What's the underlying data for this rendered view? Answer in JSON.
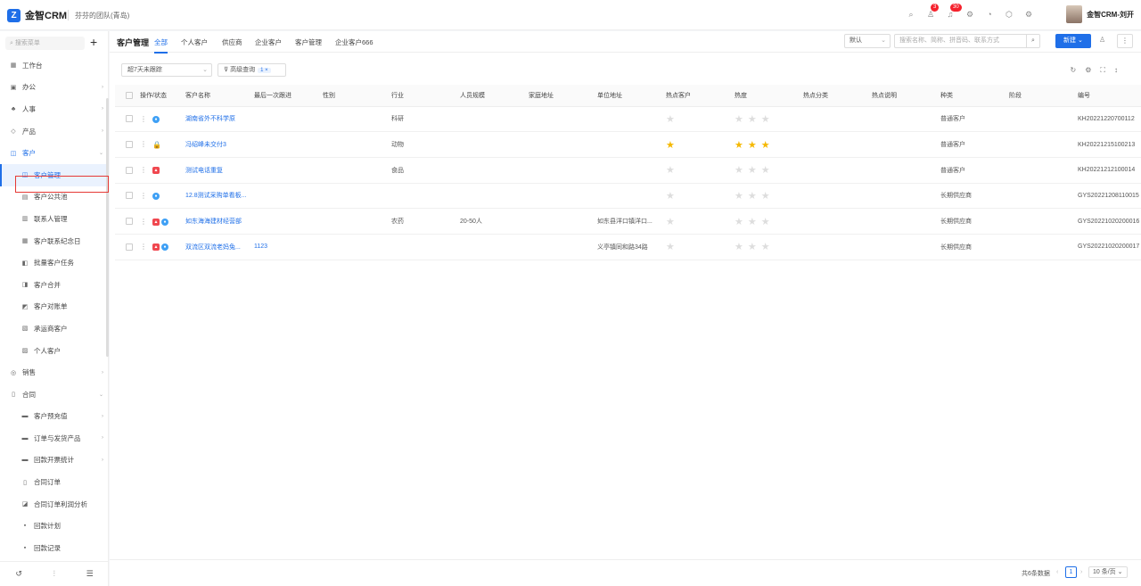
{
  "topbar": {
    "logo_glyph": "Z",
    "app_name": "金智CRM",
    "team": "芬芬的团队(青岛)",
    "icons": [
      "search-icon",
      "contacts-icon",
      "bell-icon",
      "settings-icon",
      "chart-icon",
      "shield-icon",
      "gear-icon"
    ],
    "badges": {
      "contacts": "3",
      "bell": "30"
    },
    "user_name": "金智CRM-刘开"
  },
  "sidebar": {
    "search_placeholder": "搜索菜单",
    "items": [
      {
        "label": "工作台",
        "icon": "▦",
        "level": 0
      },
      {
        "label": "办公",
        "icon": "▣",
        "level": 0,
        "arrow": "›"
      },
      {
        "label": "人事",
        "icon": "♣",
        "level": 0,
        "arrow": "›"
      },
      {
        "label": "产品",
        "icon": "◇",
        "level": 0,
        "arrow": "›"
      },
      {
        "label": "客户",
        "icon": "◫",
        "level": 0,
        "arrow": "⌄",
        "state": "expanded"
      },
      {
        "label": "客户管理",
        "icon": "◫",
        "level": 1,
        "state": "active"
      },
      {
        "label": "客户公共池",
        "icon": "▤",
        "level": 1
      },
      {
        "label": "联系人管理",
        "icon": "▥",
        "level": 1
      },
      {
        "label": "客户联系纪念日",
        "icon": "▦",
        "level": 1
      },
      {
        "label": "批量客户任务",
        "icon": "◧",
        "level": 1
      },
      {
        "label": "客户合并",
        "icon": "◨",
        "level": 1
      },
      {
        "label": "客户对账单",
        "icon": "◩",
        "level": 1
      },
      {
        "label": "承运商客户",
        "icon": "▧",
        "level": 1
      },
      {
        "label": "个人客户",
        "icon": "▨",
        "level": 1
      },
      {
        "label": "销售",
        "icon": "◎",
        "level": 0,
        "arrow": "›"
      },
      {
        "label": "合同",
        "icon": "▯",
        "level": 0,
        "arrow": "⌄"
      },
      {
        "label": "客户预充值",
        "icon": "▬",
        "level": 1,
        "arrow": "›"
      },
      {
        "label": "订单与发货产品",
        "icon": "▬",
        "level": 1,
        "arrow": "›"
      },
      {
        "label": "回款开票统计",
        "icon": "▬",
        "level": 1,
        "arrow": "›"
      },
      {
        "label": "合同订单",
        "icon": "▯",
        "level": 1
      },
      {
        "label": "合同订单利润分析",
        "icon": "◪",
        "level": 1
      },
      {
        "label": "回款计划",
        "icon": "▪",
        "level": 1
      },
      {
        "label": "回款记录",
        "icon": "▪",
        "level": 1
      }
    ]
  },
  "main": {
    "page_title": "客户管理",
    "tabs": [
      "全部",
      "个人客户",
      "供应商",
      "企业客户",
      "客户管理",
      "企业客户666"
    ],
    "view_select": "默认",
    "search_placeholder": "搜索名称、简称、拼音码、联系方式",
    "new_button": "新建",
    "filter_time": "超7天未跟踪",
    "advanced_query": "高级查询",
    "advanced_count": "1 ×",
    "columns": [
      "操作/状态",
      "客户名称",
      "最后一次跟进",
      "性别",
      "行业",
      "人员规模",
      "家庭地址",
      "单位地址",
      "热点客户",
      "热度",
      "热点分类",
      "热点说明",
      "种类",
      "阶段",
      "编号"
    ],
    "rows": [
      {
        "status": [
          "blue"
        ],
        "name": "湖南省外不科学原",
        "last_follow": "",
        "gender": "",
        "industry": "科研",
        "scale": "",
        "home": "",
        "company_addr": "",
        "hot": false,
        "heat": 0,
        "hot_cat": "",
        "hot_desc": "",
        "kind": "普通客户",
        "stage": "",
        "code": "KH20221220700112"
      },
      {
        "status": [
          "lock"
        ],
        "name": "冯绍峰未交付3",
        "last_follow": "",
        "gender": "",
        "industry": "动物",
        "scale": "",
        "home": "",
        "company_addr": "",
        "hot": true,
        "heat": 3,
        "hot_cat": "",
        "hot_desc": "",
        "kind": "普通客户",
        "stage": "",
        "code": "KH20221215100213"
      },
      {
        "status": [
          "red"
        ],
        "name": "测试电话重复",
        "last_follow": "",
        "gender": "",
        "industry": "食品",
        "scale": "",
        "home": "",
        "company_addr": "",
        "hot": false,
        "heat": 0,
        "hot_cat": "",
        "hot_desc": "",
        "kind": "普通客户",
        "stage": "",
        "code": "KH20221212100014"
      },
      {
        "status": [
          "blue"
        ],
        "name": "12.8测试采购单看板...",
        "last_follow": "",
        "gender": "",
        "industry": "",
        "scale": "",
        "home": "",
        "company_addr": "",
        "hot": false,
        "heat": 0,
        "hot_cat": "",
        "hot_desc": "",
        "kind": "长期供应商",
        "stage": "",
        "code": "GYS20221208110015"
      },
      {
        "status": [
          "red",
          "blue"
        ],
        "name": "如东海海建材经营部",
        "last_follow": "",
        "gender": "",
        "industry": "农药",
        "scale": "20-50人",
        "home": "",
        "company_addr": "如东县洋口镇洋口...",
        "hot": false,
        "heat": 0,
        "hot_cat": "",
        "hot_desc": "",
        "kind": "长期供应商",
        "stage": "",
        "code": "GYS20221020200016"
      },
      {
        "status": [
          "red",
          "blue"
        ],
        "name": "双流区双流老妈兔...",
        "last_follow": "1123",
        "gender": "",
        "industry": "",
        "scale": "",
        "home": "",
        "company_addr": "义亭镇同和路34路",
        "hot": false,
        "heat": 0,
        "hot_cat": "",
        "hot_desc": "",
        "kind": "长期供应商",
        "stage": "",
        "code": "GYS20221020200017"
      }
    ],
    "footer": {
      "total": "共6条数据",
      "page": "1",
      "page_size": "10 条/页",
      "prev": "‹",
      "next": "›"
    }
  },
  "colors": {
    "accent": "#1f6fe8",
    "highlight_box": "#e53935",
    "star": "#f5b800"
  }
}
